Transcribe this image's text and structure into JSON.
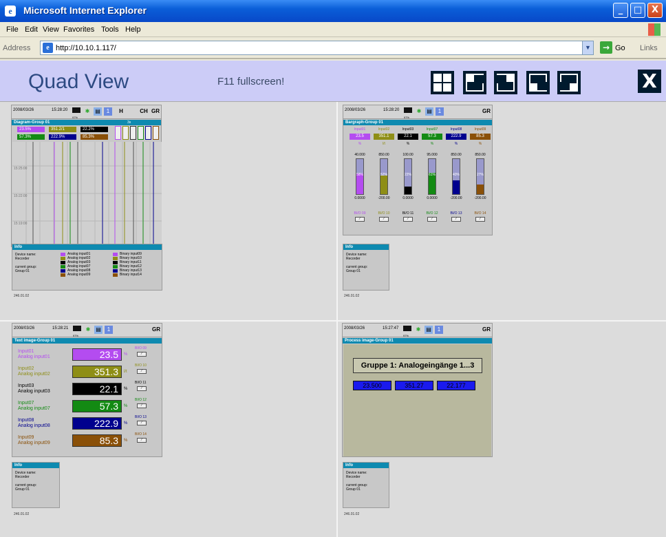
{
  "window": {
    "title": "Microsoft Internet Explorer",
    "minimize": "_",
    "maximize": "□",
    "close": "X"
  },
  "menu": [
    "File",
    "Edit",
    "View",
    "Favorites",
    "Tools",
    "Help"
  ],
  "address": {
    "label": "Address",
    "url": "http://10.10.1.117/",
    "go": "Go",
    "links": "Links"
  },
  "header": {
    "title": "Quad View",
    "hint": "F11 fullscreen!",
    "close": "X"
  },
  "quads": {
    "tl": {
      "date": "2008/03/26",
      "time": "15:28:20",
      "batt": "97%",
      "h_label": "H",
      "ch_label": "CH",
      "gr_label": "GR",
      "caption": "Diagram-Group 01",
      "rate": "3s",
      "values": [
        "23.5%",
        "351.2/1",
        "22.2%",
        "57.3%",
        "222.9%",
        "85.3%"
      ],
      "times": [
        "15:25:00",
        "15:22:00",
        "15:19:00"
      ]
    },
    "tr": {
      "date": "2008/03/26",
      "time": "15:28:20",
      "batt": "97%",
      "gr_label": "GR",
      "caption": "Bargraph-Group 01",
      "bars": [
        {
          "name": "Input01",
          "value": "23.5",
          "unit": "%",
          "max": "40.000",
          "min": "0.0000",
          "pct": "58%",
          "level": 0.58,
          "color": "#b44cf0",
          "bio": "BI/O 09"
        },
        {
          "name": "Input02",
          "value": "351.1",
          "unit": "l/t",
          "max": "850.00",
          "min": "-200.00",
          "pct": "52%",
          "level": 0.52,
          "color": "#8e8e16",
          "bio": "BI/O 10"
        },
        {
          "name": "Input03",
          "value": "22.1",
          "unit": "%",
          "max": "100.00",
          "min": "0.0000",
          "pct": "22%",
          "level": 0.22,
          "color": "#000000",
          "bio": "BI/O 11"
        },
        {
          "name": "Input07",
          "value": "57.3",
          "unit": "%",
          "max": "95.000",
          "min": "0.0000",
          "pct": "61%",
          "level": 0.61,
          "color": "#138a13",
          "bio": "BI/O 12"
        },
        {
          "name": "Input08",
          "value": "222.9",
          "unit": "%",
          "max": "850.00",
          "min": "-200.00",
          "pct": "40%",
          "level": 0.4,
          "color": "#00008e",
          "bio": "BI/O 13"
        },
        {
          "name": "Input09",
          "value": "85.3",
          "unit": "%",
          "max": "850.00",
          "min": "-200.00",
          "pct": "27%",
          "level": 0.27,
          "color": "#8a5008",
          "bio": "BI/O 14"
        }
      ]
    },
    "bl": {
      "date": "2008/03/26",
      "time": "15:28:21",
      "batt": "97%",
      "gr_label": "GR",
      "caption": "Text image-Group 01",
      "rows": [
        {
          "name": "Input01",
          "desc": "Analog input01",
          "value": "23.5",
          "unit": "%",
          "color": "#b44cf0",
          "bio": "BI/O 09"
        },
        {
          "name": "Input02",
          "desc": "Analog input02",
          "value": "351.3",
          "unit": "l/t",
          "color": "#8e8e16",
          "bio": "BI/O 10"
        },
        {
          "name": "Input03",
          "desc": "Analog input03",
          "value": "22.1",
          "unit": "%",
          "color": "#000000",
          "bio": "BI/O 11"
        },
        {
          "name": "Input07",
          "desc": "Analog input07",
          "value": "57.3",
          "unit": "%",
          "color": "#138a13",
          "bio": "BI/O 12"
        },
        {
          "name": "Input08",
          "desc": "Analog input08",
          "value": "222.9",
          "unit": "%",
          "color": "#00008e",
          "bio": "BI/O 13"
        },
        {
          "name": "Input09",
          "desc": "Analog input09",
          "value": "85.3",
          "unit": "%",
          "color": "#8a5008",
          "bio": "BI/O 14"
        }
      ]
    },
    "br": {
      "date": "2008/03/26",
      "time": "15:27:47",
      "batt": "97%",
      "gr_label": "GR",
      "caption": "Process image-Group 01",
      "heading": "Gruppe 1: Analogeingänge 1...3",
      "values": [
        "23.500",
        "351.27",
        "22.177"
      ]
    }
  },
  "info": {
    "title": "Info",
    "device_label": "Device name:",
    "device": "Recorder",
    "group_label": "current group:",
    "group": "Group 01",
    "version": "246.01.02",
    "legend_analog": [
      "Analog input01",
      "Analog input02",
      "Analog input03",
      "Analog input07",
      "Analog input08",
      "Analog input09"
    ],
    "legend_binary": [
      "Binary input09",
      "Binary input10",
      "Binary input11",
      "Binary input12",
      "Binary input13",
      "Binary input14"
    ]
  },
  "colors": [
    "#b44cf0",
    "#8e8e16",
    "#000000",
    "#138a13",
    "#00008e",
    "#8a5008"
  ]
}
